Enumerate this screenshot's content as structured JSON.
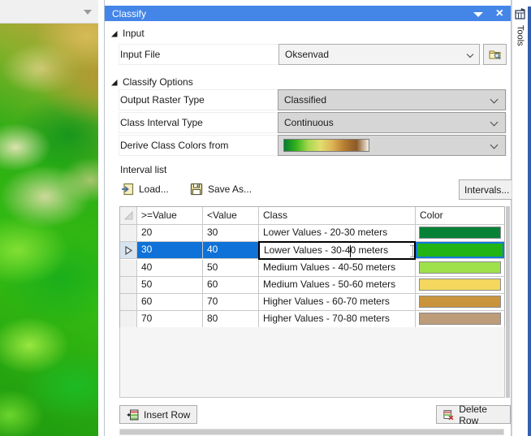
{
  "colors": {
    "titlebar_blue": "#4485e8",
    "selection_blue": "#0e72d8",
    "selected_swatch_border": "#1478dc",
    "dropdown_gray": "#d6d6d6",
    "combo_gray": "#f3f3f3",
    "tools_edge_blue": "#335fb2"
  },
  "map_panel": {
    "toolbar_icon": "dropdown-arrow-icon",
    "description": "green-gold hillshaded terrain raster preview"
  },
  "panel": {
    "title": "Classify",
    "titlebar_icons": [
      "caret-down-icon",
      "close-icon"
    ],
    "close_glyph": "×",
    "sections": {
      "input": "Input",
      "classify_options": "Classify Options"
    },
    "fields": {
      "input_file": {
        "label": "Input File",
        "value": "Oksenvad",
        "browse_icon": "folder-search-icon"
      },
      "output_raster_type": {
        "label": "Output Raster Type",
        "value": "Classified"
      },
      "class_interval_type": {
        "label": "Class Interval Type",
        "value": "Continuous"
      },
      "derive_colors": {
        "label": "Derive Class Colors  from",
        "ramp_colors": [
          "#067d2e",
          "#35b31c",
          "#a8d84e",
          "#e2de6e",
          "#ddb254",
          "#b57c30",
          "#8a5a28",
          "#f6f1e8"
        ]
      }
    },
    "interval_list_label": "Interval list",
    "toolbar": {
      "load_label": "Load...",
      "save_as_label": "Save As...",
      "intervals_label": "Intervals..."
    },
    "table": {
      "headers": {
        "gte": ">=Value",
        "lt": "<Value",
        "class": "Class",
        "color": "Color"
      },
      "rows": [
        {
          "gte": "20",
          "lt": "30",
          "class": "Lower Values - 20-30 meters",
          "color": "#068236",
          "selected": false
        },
        {
          "gte": "30",
          "lt": "40",
          "class": "Lower Values - 30-40 meters",
          "color": "#22b414",
          "selected": true,
          "editing": true
        },
        {
          "gte": "40",
          "lt": "50",
          "class": "Medium Values - 40-50 meters",
          "color": "#9fe14b",
          "selected": false
        },
        {
          "gte": "50",
          "lt": "60",
          "class": "Medium Values - 50-60 meters",
          "color": "#f3d75f",
          "selected": false
        },
        {
          "gte": "60",
          "lt": "70",
          "class": "Higher Values - 60-70 meters",
          "color": "#c9943c",
          "selected": false
        },
        {
          "gte": "70",
          "lt": "80",
          "class": "Higher Values - 70-80 meters",
          "color": "#bd9c79",
          "selected": false
        }
      ]
    },
    "footer": {
      "insert_row_label": "Insert Row",
      "delete_row_label": "Delete Row"
    }
  },
  "tools_tab": {
    "label": "Tools",
    "icon": "tools-icon"
  }
}
